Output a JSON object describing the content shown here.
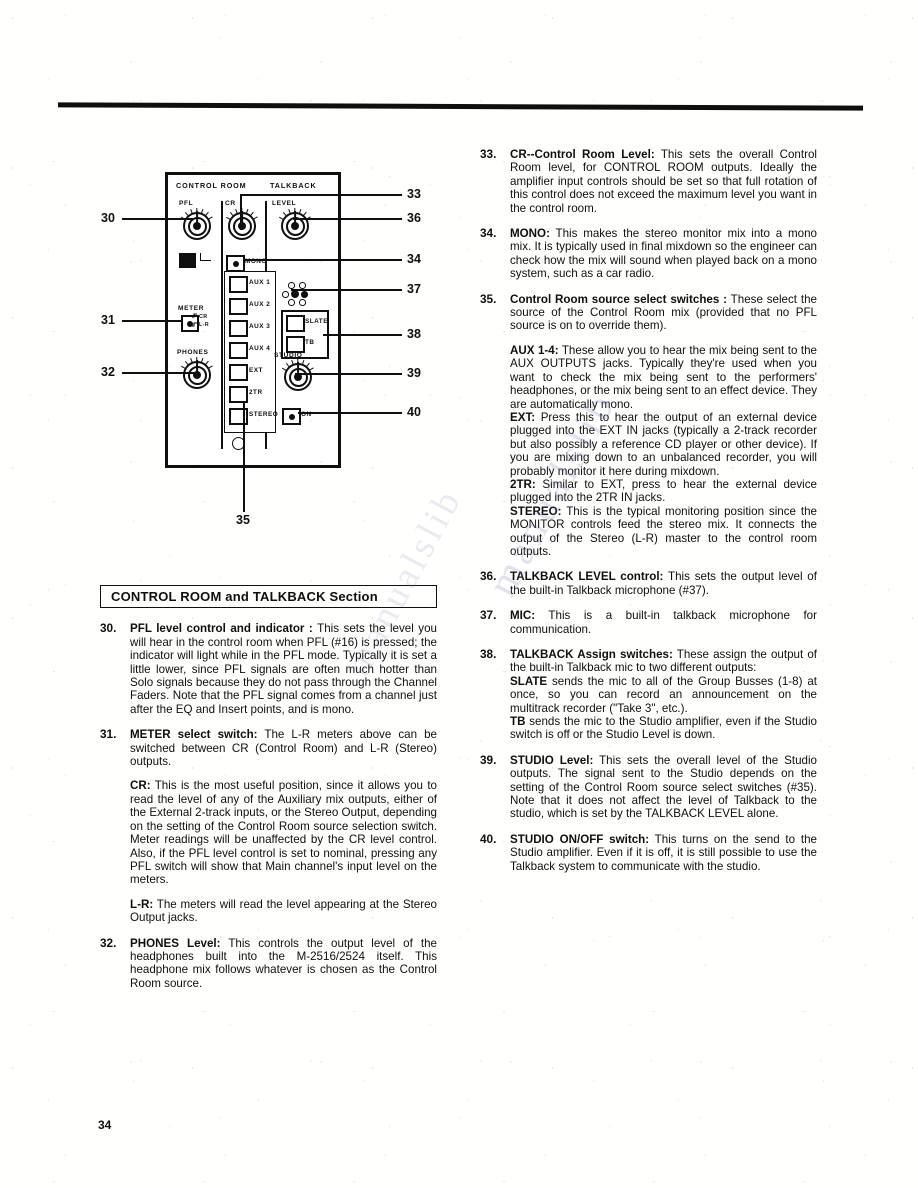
{
  "page": {
    "number": "34",
    "section_heading": "CONTROL ROOM and TALKBACK Section",
    "watermark": "manualslib"
  },
  "diagram": {
    "panel_titles": {
      "left": "CONTROL ROOM",
      "right": "TALKBACK"
    },
    "knobs": [
      {
        "name": "pfl",
        "label": "PFL"
      },
      {
        "name": "cr",
        "label": "CR"
      },
      {
        "name": "level",
        "label": "LEVEL"
      },
      {
        "name": "phones",
        "label": "PHONES"
      },
      {
        "name": "studio",
        "label": "STUDIO"
      }
    ],
    "meter_switch": {
      "label": "METER",
      "positions": [
        "CR",
        "L-R"
      ]
    },
    "mono_button": "MONO",
    "source_buttons": [
      "AUX 1",
      "AUX 2",
      "AUX 3",
      "AUX 4",
      "EXT",
      "2TR",
      "STEREO"
    ],
    "talkback_assign_buttons": [
      "SLATE",
      "TB"
    ],
    "studio_on_button": "ON",
    "callouts": {
      "left": [
        "30",
        "31",
        "32"
      ],
      "right": [
        "33",
        "36",
        "34",
        "37",
        "38",
        "39",
        "40"
      ],
      "bottom": [
        "35"
      ]
    }
  },
  "items": [
    {
      "num": "30.",
      "paragraphs": [
        {
          "lead": "PFL level control and indicator :",
          "text": " This sets the level you will hear in the control room when PFL (#16) is pressed;  the indicator will light while in the PFL mode.  Typically it is set a little lower, since PFL signals are often much hotter than Solo signals because they do not pass through the Channel  Faders.  Note that the PFL signal comes from a channel just after the EQ and Insert points, and is mono."
        }
      ]
    },
    {
      "num": "31.",
      "paragraphs": [
        {
          "lead": "METER select switch:",
          "text": "  The L-R meters above can be switched between CR (Control Room) and L-R (Stereo) outputs."
        },
        {
          "lead": "CR:",
          "text": "  This is the most useful position, since it allows you to read the level of any of the Auxiliary mix outputs, either of the External 2-track inputs, or the Stereo Output, depending on the setting of the Control Room source selection switch.   Meter readings will be unaffected by the CR level control.  Also, if the PFL level control is set to nominal, pressing any PFL switch will show that Main channel's input level on the meters."
        },
        {
          "lead": "L-R:",
          "text": "  The meters will read the level appearing at the Stereo Output jacks."
        }
      ]
    },
    {
      "num": "32.",
      "paragraphs": [
        {
          "lead": "PHONES Level:",
          "text": "  This controls the output level of the headphones built into the M-2516/2524 itself.  This headphone mix follows whatever is chosen as the Control Room  source."
        }
      ]
    },
    {
      "num": "33.",
      "paragraphs": [
        {
          "lead": "CR--Control Room Level:",
          "text": "  This sets the overall Control Room level, for CONTROL ROOM outputs.   Ideally the amplifier input controls should be set so that full rotation of this control does not exceed the maximum level you want in the control room."
        }
      ]
    },
    {
      "num": "34.",
      "paragraphs": [
        {
          "lead": "MONO:",
          "text": "  This makes the stereo monitor mix into a mono mix.  It is typically used in final mixdown so the engineer can check how the mix will sound when played back on a mono system, such as a car radio."
        }
      ]
    },
    {
      "num": "35.",
      "paragraphs": [
        {
          "lead": "Control Room source select switches :",
          "text": " These select the source of the Control Room mix (provided that no PFL source is on to override them)."
        },
        {
          "lead": "AUX 1-4:",
          "text": "  These allow you to hear the mix being sent to the AUX OUTPUTS jacks.  Typically they're used when you want to check the mix being sent to the performers' headphones, or the mix being sent to an effect device.  They are automatically mono."
        },
        {
          "lead": "EXT:",
          "text": "  Press this to hear the output of an external device plugged into the EXT IN jacks (typically a 2-track recorder but also possibly a reference CD player or other device).  If you are mixing down to an unbalanced recorder,  you will probably monitor it here during mixdown.",
          "nogap": true
        },
        {
          "lead": "2TR:",
          "text": "  Similar to EXT,  press to hear the external device plugged into the 2TR IN jacks.",
          "nogap": true
        },
        {
          "lead": "STEREO:",
          "text": "  This is the typical monitoring position since the MONITOR controls feed the stereo mix.  It connects the output of the Stereo (L-R) master to the control room outputs.",
          "nogap": true
        }
      ]
    },
    {
      "num": "36.",
      "paragraphs": [
        {
          "lead": "TALKBACK LEVEL control:",
          "text": "  This sets the output level of the built-in Talkback microphone (#37)."
        }
      ]
    },
    {
      "num": "37.",
      "paragraphs": [
        {
          "lead": "MIC:",
          "text": "  This is a built-in talkback microphone for communication."
        }
      ]
    },
    {
      "num": "38.",
      "paragraphs": [
        {
          "lead": "TALKBACK Assign switches:",
          "text": "  These assign the output of the built-in Talkback mic to two different outputs:"
        },
        {
          "lead": "SLATE",
          "text": " sends the mic to all of the Group Busses (1-8) at once, so you can record an announcement on the multitrack recorder (\"Take 3\", etc.).",
          "nogap": true
        },
        {
          "lead": "TB",
          "text": " sends the mic to the Studio amplifier, even if the Studio switch is off or the Studio Level is down.",
          "nogap": true
        }
      ]
    },
    {
      "num": "39.",
      "paragraphs": [
        {
          "lead": "STUDIO Level:",
          "text": "  This sets the overall level of the Studio outputs.   The signal sent to the Studio depends on the setting of the Control Room source select switches (#35).  Note that it does not affect the level of Talkback to the studio, which is set by the TALKBACK LEVEL alone."
        }
      ]
    },
    {
      "num": "40.",
      "paragraphs": [
        {
          "lead": "STUDIO ON/OFF switch:",
          "text": "  This turns on the send to the Studio amplifier.  Even if it is off, it is still possible to use the Talkback system to communicate with the studio."
        }
      ]
    }
  ]
}
